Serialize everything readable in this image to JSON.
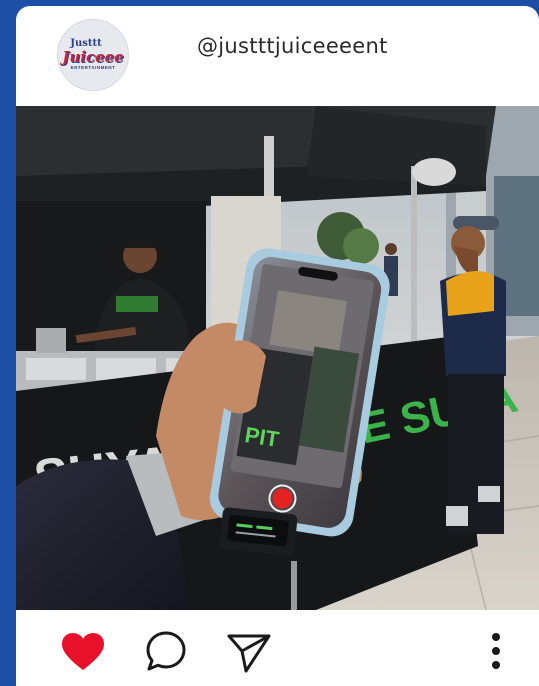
{
  "post": {
    "username": "@justttjuiceeeent",
    "avatar_logo": {
      "line1": "Justtt",
      "line2": "Juiceee",
      "line3": "ENTERTAINMENT"
    }
  },
  "photo_signage": {
    "stall_banner": "SUYA",
    "stall_sign": "THE SUYA",
    "phone_screen_text": "PIT"
  },
  "actions": {
    "like_icon": "heart-icon",
    "comment_icon": "comment-bubble-icon",
    "share_icon": "paper-plane-icon",
    "more_icon": "vertical-ellipsis-icon"
  },
  "colors": {
    "frame_blue": "#1d4fa6",
    "like_red": "#e8102a",
    "icon_dark": "#1a1a1a"
  }
}
